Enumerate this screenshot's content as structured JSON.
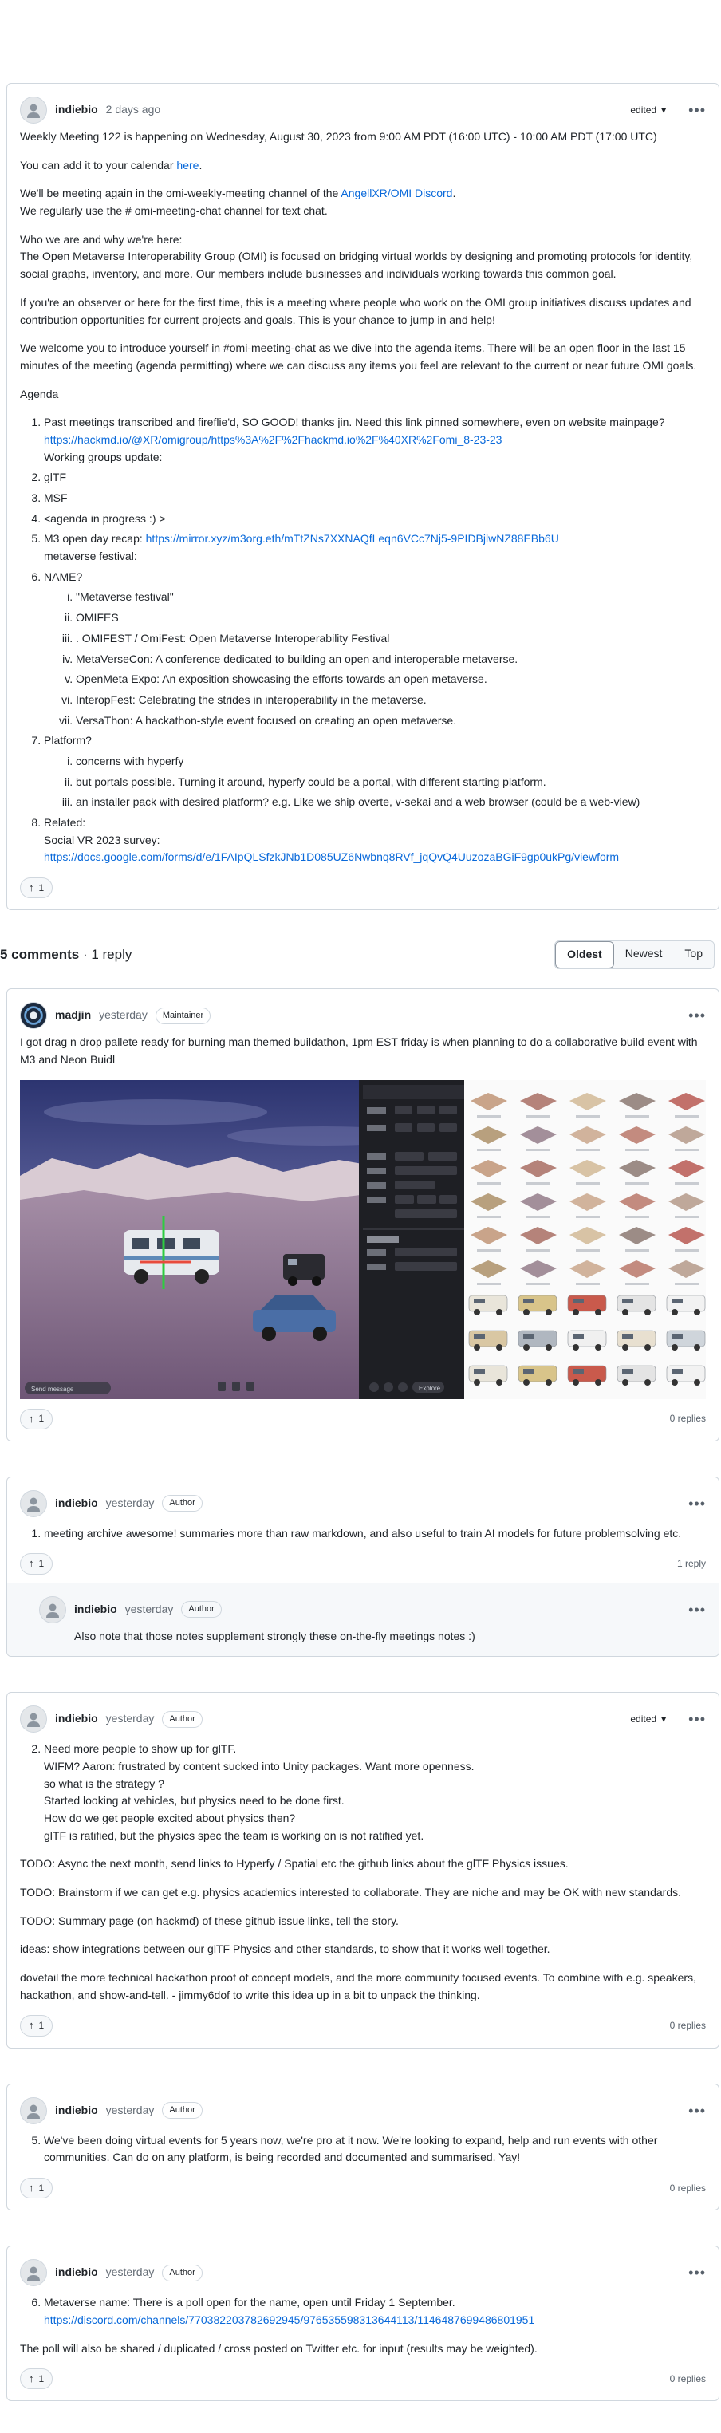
{
  "post": {
    "author": "indiebio",
    "time": "2 days ago",
    "edited": "edited",
    "p1": "Weekly Meeting 122 is happening on Wednesday, August 30, 2023 from 9:00 AM PDT (16:00 UTC) - 10:00 AM PDT (17:00 UTC)",
    "p2_pre": "You can add it to your calendar ",
    "p2_link": "here",
    "p2_post": ".",
    "p3a_pre": "We'll be meeting again in the omi-weekly-meeting channel of the ",
    "p3a_link": "AngellXR/OMI Discord",
    "p3a_post": ".",
    "p3b": "We regularly use the # omi-meeting-chat channel for text chat.",
    "p4a": "Who we are and why we're here:",
    "p4b": "The Open Metaverse Interoperability Group (OMI) is focused on bridging virtual worlds by designing and promoting protocols for identity, social graphs, inventory, and more. Our members include businesses and individuals working towards this common goal.",
    "p5": "If you're an observer or here for the first time, this is a meeting where people who work on the OMI group initiatives discuss updates and contribution opportunities for current projects and goals. This is your chance to jump in and help!",
    "p6": "We welcome you to introduce yourself in #omi-meeting-chat as we dive into the agenda items. There will be an open floor in the last 15 minutes of the meeting (agenda permitting) where we can discuss any items you feel are relevant to the current or near future OMI goals.",
    "agenda": "Agenda",
    "i1": "Past meetings transcribed and fireflie'd, SO GOOD! thanks jin. Need this link pinned somewhere, even on website mainpage?",
    "i1_link": "https://hackmd.io/@XR/omigroup/https%3A%2F%2Fhackmd.io%2F%40XR%2Fomi_8-23-23",
    "i1_sub": "Working groups update:",
    "i2": "glTF",
    "i3": "MSF",
    "i4": "<agenda in progress :) >",
    "i5_pre": "M3 open day recap: ",
    "i5_link": "https://mirror.xyz/m3org.eth/mTtZNs7XXNAQfLeqn6VCc7Nj5-9PIDBjlwNZ88EBb6U",
    "i5_sub": "metaverse festival:",
    "i6": "NAME?",
    "names": [
      "\"Metaverse festival\"",
      "OMIFES",
      ". OMIFEST / OmiFest: Open Metaverse Interoperability Festival",
      "MetaVerseCon: A conference dedicated to building an open and interoperable metaverse.",
      "OpenMeta Expo: An exposition showcasing the efforts towards an open metaverse.",
      "InteropFest: Celebrating the strides in interoperability in the metaverse.",
      "VersaThon: A hackathon-style event focused on creating an open metaverse."
    ],
    "i7": "Platform?",
    "platforms": [
      "concerns with hyperfy",
      "but portals possible. Turning it around, hyperfy could be a portal, with different starting platform.",
      "an installer pack with desired platform? e.g. Like we ship overte, v-sekai and a web browser (could be a web-view)"
    ],
    "i8": "Related:",
    "i8_sub": "Social VR 2023 survey:",
    "i8_link": "https://docs.google.com/forms/d/e/1FAIpQLSfzkJNb1D085UZ6Nwbnq8RVf_jqQvQ4UuzozaBGiF9gp0ukPg/viewform",
    "upvotes": "1"
  },
  "toolbar": {
    "count": "5 comments",
    "replies": "· 1 reply",
    "oldest": "Oldest",
    "newest": "Newest",
    "top": "Top"
  },
  "c1": {
    "author": "madjin",
    "time": "yesterday",
    "badge": "Maintainer",
    "text": "I got drag n drop pallete ready for burning man themed buildathon, 1pm EST friday is when planning to do a collaborative build event with M3 and Neon Buidl",
    "upvotes": "1",
    "replies": "0 replies",
    "ui_send": "Send message",
    "ui_explore": "Explore"
  },
  "c2": {
    "author": "indiebio",
    "time": "yesterday",
    "badge": "Author",
    "text": "meeting archive awesome! summaries more than raw markdown, and also useful to train AI models for future problemsolving etc.",
    "upvotes": "1",
    "replies": "1 reply",
    "reply": {
      "author": "indiebio",
      "time": "yesterday",
      "badge": "Author",
      "text": "Also note that those notes supplement strongly these on-the-fly meetings notes :)"
    }
  },
  "c3": {
    "author": "indiebio",
    "time": "yesterday",
    "badge": "Author",
    "edited": "edited",
    "l1": "Need more people to show up for glTF.",
    "l2": "WIFM? Aaron: frustrated by content sucked into Unity packages. Want more openness.",
    "l3": "so what is the strategy ?",
    "l4": "Started looking at vehicles, but physics need to be done first.",
    "l5": "How do we get people excited about physics then?",
    "l6": "glTF is ratified, but the physics spec the team is working on is not ratified yet.",
    "p1": "TODO: Async the next month, send links to Hyperfy / Spatial etc the github links about the glTF Physics issues.",
    "p2": "TODO: Brainstorm if we can get e.g. physics academics interested to collaborate. They are niche and may be OK with new standards.",
    "p3": "TODO: Summary page (on hackmd) of these github issue links, tell the story.",
    "p4": "ideas: show integrations between our glTF Physics and other standards, to show that it works well together.",
    "p5": "dovetail the more technical hackathon proof of concept models, and the more community focused events. To combine with e.g. speakers, hackathon, and show-and-tell. - jimmy6dof to write this idea up in a bit to unpack the thinking.",
    "upvotes": "1",
    "replies": "0 replies"
  },
  "c4": {
    "author": "indiebio",
    "time": "yesterday",
    "badge": "Author",
    "text": "We've been doing virtual events for 5 years now, we're pro at it now. We're looking to expand, help and run events with other communities. Can do on any platform, is being recorded and documented and summarised. Yay!",
    "upvotes": "1",
    "replies": "0 replies"
  },
  "c5": {
    "author": "indiebio",
    "time": "yesterday",
    "badge": "Author",
    "text": "Metaverse name: There is a poll open for the name, open until Friday 1 September.",
    "link": "https://discord.com/channels/770382203782692945/976535598313644113/1146487699486801951",
    "p": "The poll will also be shared / duplicated / cross posted on Twitter etc. for input (results may be weighted).",
    "upvotes": "1",
    "replies": "0 replies"
  }
}
